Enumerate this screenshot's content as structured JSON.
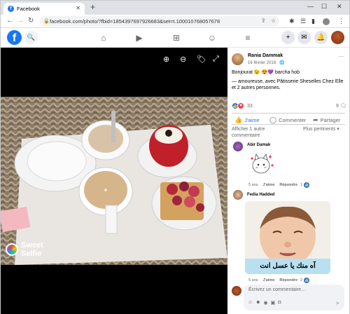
{
  "browser": {
    "tab_title": "Facebook",
    "new_tab": "+",
    "url": "facebook.com/photo/?fbid=1854397697926683&set=t.100010768057678",
    "minimize": "—",
    "maximize": "☐",
    "close": "✕"
  },
  "post": {
    "author": "Rania Dammak",
    "date": "16 février 2018 · 🌐",
    "text_line1": "Bonjourat 😉 😍💜 barcha hob",
    "text_line2": "— amoureuse, avec Pâtisserie Sheselles Chez Elle et 2 autres personnes.",
    "reaction_count": "33",
    "comment_count": "9",
    "like_label": "J'aime",
    "comment_label": "Commenter",
    "share_label": "Partager",
    "more_comments": "Afficher 1 autre commentaire",
    "relevant": "Plus pertinents ▾"
  },
  "comments": [
    {
      "author": "Abir Damak",
      "age": "5 ans",
      "like": "J'aime",
      "reply": "Répondre",
      "likes": "1"
    },
    {
      "author": "Fedia Hadded",
      "age": "5 ans",
      "like": "J'aime",
      "reply": "Répondre",
      "likes": "2"
    }
  ],
  "meme_caption": "آه منك يا عسل انت",
  "photo_watermark": {
    "line1": "Sweet",
    "line2": "Selfie"
  },
  "write_placeholder": "Écrivez un commentaire…",
  "colors": {
    "fb_blue": "#1877f2",
    "viewer_bg": "#000000"
  }
}
